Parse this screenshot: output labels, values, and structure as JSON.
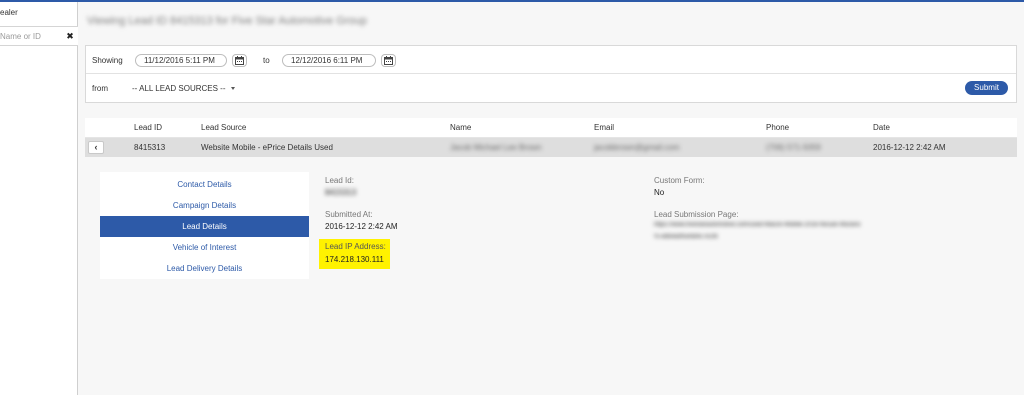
{
  "sidebar": {
    "title": "ealer",
    "search_placeholder": "Name or ID",
    "clear_glyph": "✖"
  },
  "page": {
    "title": "Viewing Lead ID 8415313 for Five Star Automotive Group"
  },
  "filters": {
    "showing_label": "Showing",
    "start_date": "11/12/2016 5:11 PM",
    "to_label": "to",
    "end_date": "12/12/2016 6:11 PM",
    "from_label": "from",
    "lead_source_selected": "-- ALL LEAD SOURCES --",
    "submit_label": "Submit",
    "calendar_icon": "calendar-icon"
  },
  "table": {
    "columns": [
      "Lead ID",
      "Lead Source",
      "Name",
      "Email",
      "Phone",
      "Date"
    ],
    "row": {
      "back_glyph": "‹",
      "lead_id": "8415313",
      "lead_source": "Website Mobile - ePrice Details Used",
      "name": "Jacob Michael Lee Brown",
      "email": "jacobbrown@gmail.com",
      "phone": "(706) 571-5059",
      "date": "2016-12-12 2:42 AM"
    }
  },
  "detail_nav": {
    "items": [
      {
        "label": "Contact Details",
        "active": false
      },
      {
        "label": "Campaign Details",
        "active": false
      },
      {
        "label": "Lead Details",
        "active": true
      },
      {
        "label": "Vehicle of Interest",
        "active": false
      },
      {
        "label": "Lead Delivery Details",
        "active": false
      }
    ]
  },
  "lead_details": {
    "lead_id_label": "Lead Id:",
    "lead_id_value": "8415313",
    "submitted_label": "Submitted At:",
    "submitted_value": "2016-12-12 2:42 AM",
    "ip_label": "Lead IP Address:",
    "ip_value": "174.218.130.111",
    "custom_form_label": "Custom Form:",
    "custom_form_value": "No",
    "submission_page_label": "Lead Submission Page:",
    "submission_page_line1": "https://www.fivestarautomotive.com/used-Macon-Mobile-2016-Nissan-Murano",
    "submission_page_line2": "%-e8b4a9f5e9d4c7e1f6"
  },
  "colors": {
    "accent": "#2d5aa8",
    "highlight": "#fff200",
    "row_bg": "#dedede"
  }
}
